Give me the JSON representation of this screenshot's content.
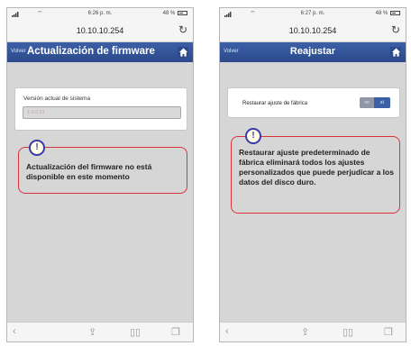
{
  "left": {
    "status": {
      "time": "6:26 p. m.",
      "battery": "48 %"
    },
    "url": "10.10.10.254",
    "header": {
      "back_label": "Volver",
      "title": "Actualización de firmware"
    },
    "card": {
      "label": "Versión actual de sistema",
      "version_value": "1.0.0.21"
    },
    "warning": {
      "icon": "!",
      "text": "Actualización del firmware no está disponible en este momento"
    }
  },
  "right": {
    "status": {
      "time": "6:27 p. m.",
      "battery": "48 %"
    },
    "url": "10.10.10.254",
    "header": {
      "back_label": "Volver",
      "title": "Reajustar"
    },
    "card": {
      "label": "Restaurar ajuste de fábrica",
      "toggle_off": "no",
      "toggle_on": "sí"
    },
    "warning": {
      "icon": "!",
      "text": "Restaurar ajuste predeterminado de fábrica eliminará todos los ajustes personalizados que puede perjudicar a los datos del disco duro."
    }
  },
  "icons": {
    "reload": "reload-icon",
    "home": "home-icon",
    "back": "back-arrow-icon",
    "share": "share-icon",
    "bookmarks": "bookmarks-icon",
    "tabs": "tabs-icon"
  },
  "colors": {
    "header": "#3c5fa6",
    "warning_border": "#d8323c",
    "warning_icon": "#3a3aa8",
    "toggle_on": "#3c5fa6"
  }
}
